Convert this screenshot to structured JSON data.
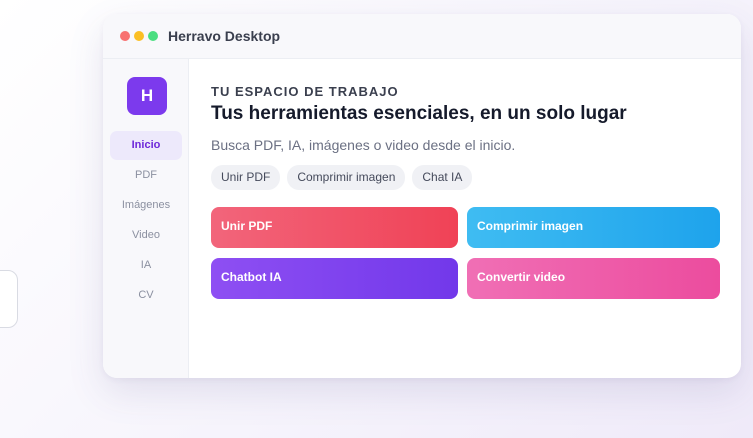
{
  "window": {
    "title": "Herravo Desktop"
  },
  "sidebar": {
    "logo_letter": "H",
    "items": [
      {
        "label": "Inicio",
        "active": true
      },
      {
        "label": "PDF"
      },
      {
        "label": "Imágenes"
      },
      {
        "label": "Video"
      },
      {
        "label": "IA"
      },
      {
        "label": "CV"
      }
    ]
  },
  "main": {
    "eyebrow": "TU ESPACIO DE TRABAJO",
    "headline": "Tus herramientas esenciales, en un solo lugar",
    "subtitle": "Busca PDF, IA, imágenes o video desde el inicio.",
    "chips": [
      "Unir PDF",
      "Comprimir imagen",
      "Chat IA"
    ],
    "tools": [
      {
        "label": "Unir PDF",
        "color": "#f04256"
      },
      {
        "label": "Comprimir imagen",
        "color": "#1ea3ec"
      },
      {
        "label": "Chatbot IA",
        "color": "#7238ea"
      },
      {
        "label": "Convertir video",
        "color": "#ec4c9e"
      }
    ]
  },
  "colors": {
    "accent": "#7c3aed"
  }
}
